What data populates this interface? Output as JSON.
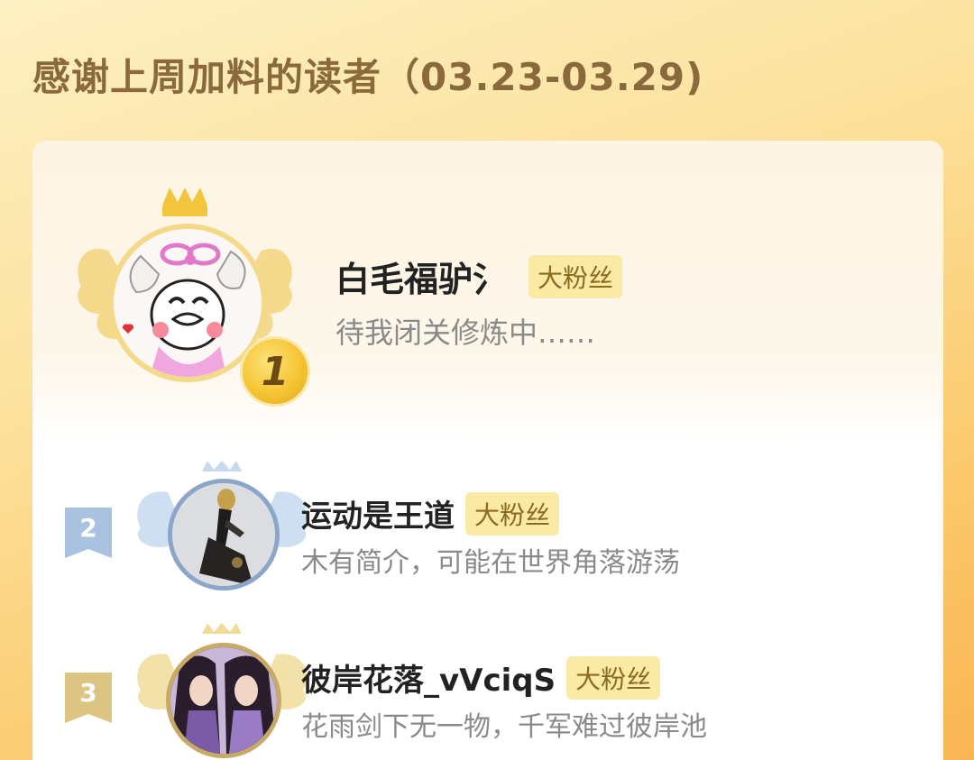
{
  "header": {
    "title": "感谢上周加料的读者（03.23-03.29)"
  },
  "readers": [
    {
      "rank": "1",
      "name": "白毛福驴氵",
      "badge": "大粉丝",
      "bio": "待我闭关修炼中……",
      "avatar_icon": "cartoon-bunny-avatar"
    },
    {
      "rank": "2",
      "name": "运动是王道",
      "badge": "大粉丝",
      "bio": "木有简介，可能在世界角落游荡",
      "avatar_icon": "figure-statue-avatar"
    },
    {
      "rank": "3",
      "name": "彼岸花落_vVciqS",
      "badge": "大粉丝",
      "bio": "花雨剑下无一物，千军难过彼岸池",
      "avatar_icon": "twin-heroines-avatar"
    }
  ],
  "colors": {
    "gold": "#f2c53d",
    "silver": "#a9c2df",
    "bronze": "#dcc583",
    "badge_bg": "#fbeaa6",
    "badge_text": "#8a6b1f"
  }
}
